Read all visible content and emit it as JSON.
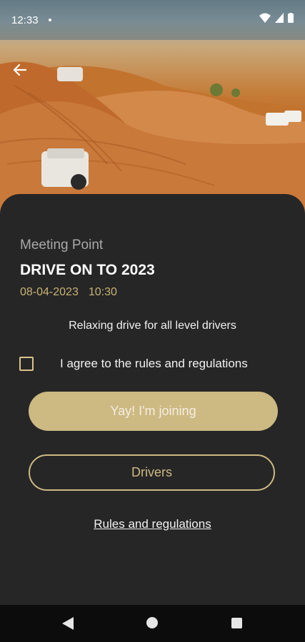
{
  "status_bar": {
    "time": "12:33"
  },
  "event": {
    "meeting_label": "Meeting Point",
    "title": "DRIVE ON TO 2023",
    "date": "08-04-2023",
    "time": "10:30",
    "description": "Relaxing drive for all level drivers"
  },
  "agreement": {
    "label": "I agree to the rules and regulations",
    "checked": false
  },
  "buttons": {
    "join": "Yay! I'm joining",
    "drivers": "Drivers"
  },
  "links": {
    "rules": "Rules and regulations"
  },
  "colors": {
    "accent": "#cdb982",
    "background": "#262626",
    "nav_bar": "#0c0c0c"
  }
}
